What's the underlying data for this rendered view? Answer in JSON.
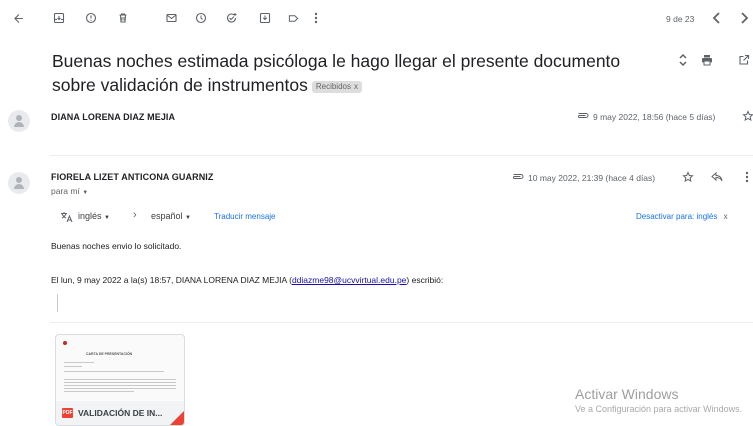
{
  "toolbar": {
    "pagination": "9 de 23"
  },
  "subject": {
    "text": "Buenas noches estimada psicóloga le hago llegar el presente documento sobre validación de instrumentos",
    "label_chip": "Recibidos",
    "label_chip_close": "x"
  },
  "messages": [
    {
      "sender": "DIANA LORENA DIAZ MEJIA",
      "date": "9 may 2022, 18:56 (hace 5 días)"
    },
    {
      "sender": "FIORELA LIZET ANTICONA GUARNIZ",
      "date": "10 may 2022, 21:39 (hace 4 días)",
      "to": "para mí",
      "translate": {
        "from_lang": "inglés",
        "to_lang": "español",
        "translate_link": "Traducir mensaje",
        "disable_link": "Desactivar para: inglés",
        "disable_close": "x"
      },
      "body": "Buenas noches envio lo solicitado.",
      "quote_header_prefix": "El lun, 9 may 2022 a la(s) 18:57, DIANA LORENA DIAZ MEJIA (",
      "quote_email": "ddiazme98@ucvvirtual.edu.pe",
      "quote_header_suffix": ") escribió:",
      "attachment": {
        "badge": "PDF",
        "name": "VALIDACIÓN DE IN...",
        "doc_heading": "CARTA DE PRESENTACIÓN"
      }
    }
  ],
  "watermark": {
    "title": "Activar Windows",
    "subtitle": "Ve a Configuración para activar Windows."
  },
  "colors": {
    "link": "#1a0dab",
    "translate_link": "#1a73e8",
    "pdf_red": "#ea4335"
  }
}
